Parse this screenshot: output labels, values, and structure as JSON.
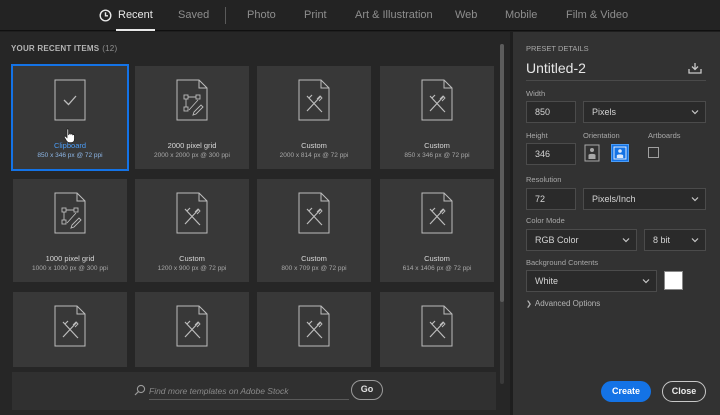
{
  "tabs": [
    {
      "label": "Recent",
      "active": true
    },
    {
      "label": "Saved"
    },
    {
      "label": "Photo"
    },
    {
      "label": "Print"
    },
    {
      "label": "Art & Illustration"
    },
    {
      "label": "Web"
    },
    {
      "label": "Mobile"
    },
    {
      "label": "Film & Video"
    }
  ],
  "recent": {
    "title": "YOUR RECENT ITEMS",
    "count": "(12)",
    "items": [
      {
        "name": "Clipboard",
        "info": "850 x 346 px @ 72 ppi",
        "icon": "clipboard-icon",
        "selected": true
      },
      {
        "name": "2000 pixel grid",
        "info": "2000 x 2000 px @ 300 ppi",
        "icon": "grid-document-icon"
      },
      {
        "name": "Custom",
        "info": "2000 x 814 px @ 72 ppi",
        "icon": "custom-document-icon"
      },
      {
        "name": "Custom",
        "info": "850 x 346 px @ 72 ppi",
        "icon": "custom-document-icon"
      },
      {
        "name": "1000 pixel grid",
        "info": "1000 x 1000 px @ 300 ppi",
        "icon": "grid-document-icon"
      },
      {
        "name": "Custom",
        "info": "1200 x 900 px @ 72 ppi",
        "icon": "custom-document-icon"
      },
      {
        "name": "Custom",
        "info": "800 x 709 px @ 72 ppi",
        "icon": "custom-document-icon"
      },
      {
        "name": "Custom",
        "info": "614 x 1406 px @ 72 ppi",
        "icon": "custom-document-icon"
      },
      {
        "name": "",
        "info": "",
        "icon": "custom-document-icon"
      },
      {
        "name": "",
        "info": "",
        "icon": "custom-document-icon"
      },
      {
        "name": "",
        "info": "",
        "icon": "custom-document-icon"
      },
      {
        "name": "",
        "info": "",
        "icon": "custom-document-icon"
      }
    ]
  },
  "stock": {
    "placeholder": "Find more templates on Adobe Stock",
    "go_label": "Go"
  },
  "preset": {
    "section_label": "PRESET DETAILS",
    "name": "Untitled-2",
    "width_label": "Width",
    "width_value": "850",
    "width_unit": "Pixels",
    "height_label": "Height",
    "height_value": "346",
    "orientation_label": "Orientation",
    "artboards_label": "Artboards",
    "artboards_checked": false,
    "resolution_label": "Resolution",
    "resolution_value": "72",
    "resolution_unit": "Pixels/Inch",
    "color_mode_label": "Color Mode",
    "color_mode": "RGB Color",
    "bit_depth": "8 bit",
    "background_label": "Background Contents",
    "background_value": "White",
    "background_color": "#ffffff",
    "advanced_label": "Advanced Options"
  },
  "actions": {
    "create_label": "Create",
    "close_label": "Close"
  },
  "colors": {
    "accent": "#1473e6",
    "panel": "#323232",
    "background": "#262626"
  }
}
